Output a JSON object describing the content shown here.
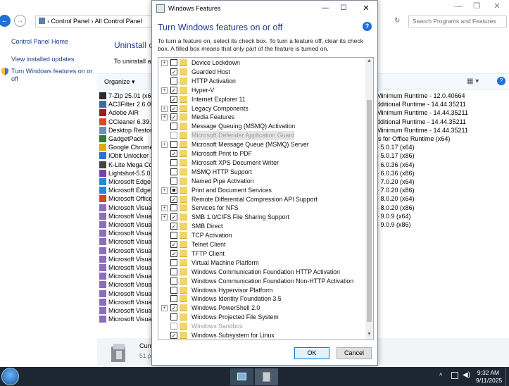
{
  "cp": {
    "window_buttons": [
      "—",
      "❐",
      "✕"
    ],
    "address_parts": [
      "Control Panel",
      "›",
      "All Control Panel"
    ],
    "search_placeholder": "Search Programs and Features",
    "left_links": [
      "Control Panel Home",
      "View installed updates",
      "Turn Windows features on or off"
    ],
    "main_title": "Uninstall o",
    "main_desc": "To uninstall a p",
    "organize": "Organize ▾",
    "programs": [
      {
        "name": "7-Zip 25.01 (x64)",
        "icon_color": "#2b2b2b"
      },
      {
        "name": "AC3Filter 2.6.0b",
        "icon_color": "#3a6ea5"
      },
      {
        "name": "Adobe AIR",
        "icon_color": "#9c1c1c"
      },
      {
        "name": "CCleaner 6.39.11",
        "icon_color": "#d44a2a"
      },
      {
        "name": "Desktop Restore",
        "icon_color": "#6b8fb5"
      },
      {
        "name": "GadgetPack",
        "icon_color": "#2f7a3a"
      },
      {
        "name": "Google Chrome",
        "icon_color": "#e0a800"
      },
      {
        "name": "IObit Unlocker 1",
        "icon_color": "#2a6fd6"
      },
      {
        "name": "K-Lite Mega Cod",
        "icon_color": "#444444"
      },
      {
        "name": "Lightshot-5.5.0.7",
        "icon_color": "#7a3fb0"
      },
      {
        "name": "Microsoft Edge",
        "icon_color": "#1f8ad6"
      },
      {
        "name": "Microsoft Edge W",
        "icon_color": "#1f8ad6"
      },
      {
        "name": "Microsoft Office",
        "icon_color": "#d24726"
      },
      {
        "name": "Microsoft Visual",
        "icon_color": "#8c6fb8"
      },
      {
        "name": "Microsoft Visual",
        "icon_color": "#8c6fb8"
      },
      {
        "name": "Microsoft Visual",
        "icon_color": "#8c6fb8"
      },
      {
        "name": "Microsoft Visual",
        "icon_color": "#8c6fb8"
      },
      {
        "name": "Microsoft Visual",
        "icon_color": "#8c6fb8"
      },
      {
        "name": "Microsoft Visual",
        "icon_color": "#8c6fb8"
      },
      {
        "name": "Microsoft Visual",
        "icon_color": "#8c6fb8"
      },
      {
        "name": "Microsoft Visual",
        "icon_color": "#8c6fb8"
      },
      {
        "name": "Microsoft Visual",
        "icon_color": "#8c6fb8"
      },
      {
        "name": "Microsoft Visual",
        "icon_color": "#8c6fb8"
      },
      {
        "name": "Microsoft Visual",
        "icon_color": "#8c6fb8"
      },
      {
        "name": "Microsoft Visual",
        "icon_color": "#8c6fb8"
      },
      {
        "name": "Microsoft Visual",
        "icon_color": "#8c6fb8"
      },
      {
        "name": "Microsoft Visual",
        "icon_color": "#8c6fb8"
      }
    ],
    "publisher_col": [
      "Minimum Runtime - 12.0.40664",
      "dditional Runtime - 14.44.35211",
      "Minimum Runtime - 14.44.35211",
      "dditional Runtime - 14.44.35211",
      "Minimum Runtime - 14.44.35211",
      "ls for Office Runtime (x64)",
      "- 5.0.17 (x64)",
      "- 5.0.17 (x86)",
      "- 6.0.36 (x64)",
      "- 6.0.36 (x86)",
      "- 7.0.20 (x64)",
      "- 7.0.20 (x86)",
      "- 8.0.20 (x64)",
      "- 8.0.20 (x86)",
      "- 9.0.9 (x64)",
      "- 9.0.9 (x86)"
    ],
    "bottom_title": "Curr",
    "bottom_sub": "51 p"
  },
  "dialog": {
    "title": "Windows Features",
    "window_buttons": [
      "—",
      "☐",
      "✕"
    ],
    "heading": "Turn Windows features on or off",
    "description": "To turn a feature on, select its check box. To turn a feature off, clear its check box. A filled box means that only part of the feature is turned on.",
    "features": [
      {
        "label": "Device Lockdown",
        "state": "off",
        "expand": true,
        "disabled": false
      },
      {
        "label": "Guarded Host",
        "state": "on",
        "expand": false,
        "disabled": false
      },
      {
        "label": "HTTP Activation",
        "state": "off",
        "expand": false,
        "disabled": false
      },
      {
        "label": "Hyper-V",
        "state": "on",
        "expand": true,
        "disabled": false
      },
      {
        "label": "Internet Explorer 11",
        "state": "on",
        "expand": false,
        "disabled": false
      },
      {
        "label": "Legacy Components",
        "state": "on",
        "expand": true,
        "disabled": false
      },
      {
        "label": "Media Features",
        "state": "on",
        "expand": true,
        "disabled": false
      },
      {
        "label": "Message Queuing (MSMQ) Activation",
        "state": "off",
        "expand": false,
        "disabled": false
      },
      {
        "label": "Microsoft Defender Application Guard",
        "state": "off",
        "expand": false,
        "disabled": true,
        "selected": true
      },
      {
        "label": "Microsoft Message Queue (MSMQ) Server",
        "state": "off",
        "expand": true,
        "disabled": false
      },
      {
        "label": "Microsoft Print to PDF",
        "state": "on",
        "expand": false,
        "disabled": false
      },
      {
        "label": "Microsoft XPS Document Writer",
        "state": "off",
        "expand": false,
        "disabled": false
      },
      {
        "label": "MSMQ HTTP Support",
        "state": "off",
        "expand": false,
        "disabled": false
      },
      {
        "label": "Named Pipe Activation",
        "state": "off",
        "expand": false,
        "disabled": false
      },
      {
        "label": "Print and Document Services",
        "state": "partial",
        "expand": true,
        "disabled": false
      },
      {
        "label": "Remote Differential Compression API Support",
        "state": "on",
        "expand": false,
        "disabled": false
      },
      {
        "label": "Services for NFS",
        "state": "off",
        "expand": true,
        "disabled": false
      },
      {
        "label": "SMB 1.0/CIFS File Sharing Support",
        "state": "on",
        "expand": true,
        "disabled": false
      },
      {
        "label": "SMB Direct",
        "state": "on",
        "expand": false,
        "disabled": false
      },
      {
        "label": "TCP Activation",
        "state": "off",
        "expand": false,
        "disabled": false
      },
      {
        "label": "Telnet Client",
        "state": "on",
        "expand": false,
        "disabled": false
      },
      {
        "label": "TFTP Client",
        "state": "on",
        "expand": false,
        "disabled": false
      },
      {
        "label": "Virtual Machine Platform",
        "state": "off",
        "expand": false,
        "disabled": false
      },
      {
        "label": "Windows Communication Foundation HTTP Activation",
        "state": "off",
        "expand": false,
        "disabled": false
      },
      {
        "label": "Windows Communication Foundation Non-HTTP Activation",
        "state": "off",
        "expand": false,
        "disabled": false
      },
      {
        "label": "Windows Hypervisor Platform",
        "state": "off",
        "expand": false,
        "disabled": false
      },
      {
        "label": "Windows Identity Foundation 3.5",
        "state": "off",
        "expand": false,
        "disabled": false
      },
      {
        "label": "Windows PowerShell 2.0",
        "state": "on",
        "expand": true,
        "disabled": false
      },
      {
        "label": "Windows Projected File System",
        "state": "off",
        "expand": false,
        "disabled": false
      },
      {
        "label": "Windows Sandbox",
        "state": "off",
        "expand": false,
        "disabled": true
      },
      {
        "label": "Windows Subsystem for Linux",
        "state": "on",
        "expand": false,
        "disabled": false
      }
    ],
    "ok_label": "OK",
    "cancel_label": "Cancel"
  },
  "taskbar": {
    "time": "9:32 AM",
    "date": "9/11/2025",
    "tray": "^"
  },
  "colors": {
    "accent": "#0078d7",
    "link": "#1a3e8c",
    "taskbar": "#1d2733"
  }
}
